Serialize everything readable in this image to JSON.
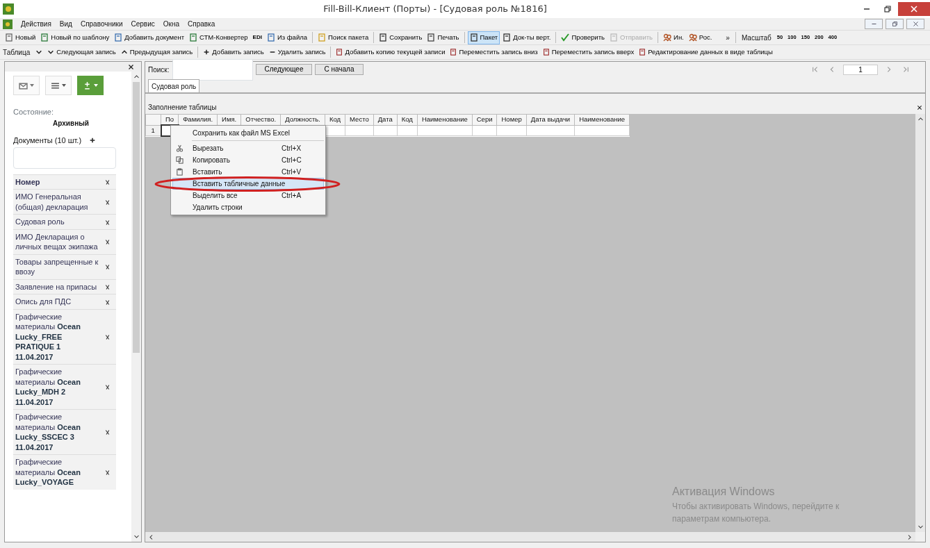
{
  "window": {
    "title": "Fill-Bill-Клиент (Порты) - [Судовая роль №1816]"
  },
  "menu": [
    "Действия",
    "Вид",
    "Справочники",
    "Сервис",
    "Окна",
    "Справка"
  ],
  "toolbar": [
    {
      "label": "Новый",
      "kind": "button",
      "selected": false,
      "disabled": false
    },
    {
      "label": "Новый по шаблону",
      "kind": "button",
      "selected": false,
      "disabled": false
    },
    {
      "label": "Добавить документ",
      "kind": "button",
      "selected": false,
      "disabled": false
    },
    {
      "label": "СТМ-Конвертер",
      "kind": "button",
      "selected": false,
      "disabled": false
    },
    {
      "label": "EDI",
      "kind": "badge",
      "selected": false,
      "disabled": false
    },
    {
      "label": "Из файла",
      "kind": "button",
      "selected": false,
      "disabled": false
    },
    {
      "label": "Поиск пакета",
      "kind": "button",
      "selected": false,
      "disabled": false
    },
    {
      "label": "Сохранить",
      "kind": "button",
      "selected": false,
      "disabled": false
    },
    {
      "label": "Печать",
      "kind": "button",
      "selected": false,
      "disabled": false
    },
    {
      "label": "Пакет",
      "kind": "button",
      "selected": true,
      "disabled": false
    },
    {
      "label": "Док-ты верт.",
      "kind": "button",
      "selected": false,
      "disabled": false
    },
    {
      "label": "Проверить",
      "kind": "button",
      "selected": false,
      "disabled": false
    },
    {
      "label": "Отправить",
      "kind": "button",
      "selected": false,
      "disabled": true
    },
    {
      "label": "Ин.",
      "kind": "button",
      "selected": false,
      "disabled": false
    },
    {
      "label": "Рос.",
      "kind": "button",
      "selected": false,
      "disabled": false
    }
  ],
  "overflow": "»",
  "zoom": {
    "label": "Масштаб",
    "levels": [
      "50",
      "100",
      "150",
      "200",
      "400"
    ]
  },
  "record_toolbar": [
    "Таблица",
    "Следующая запись",
    "Предыдущая запись",
    "Добавить запись",
    "Удалить запись",
    "Добавить копию текущей записи",
    "Переместить запись вниз",
    "Переместить запись вверх",
    "Редактирование данных в виде таблицы"
  ],
  "pager": {
    "value": "1"
  },
  "sidebar": {
    "state_label": "Состояние:",
    "state_value": "Архивный",
    "documents_label": "Документы (10 шт.)",
    "column": "Номер",
    "documents": [
      "ИМО Генеральная (общая) декларация",
      "Судовая роль",
      "ИМО Декларация о личных вещах экипажа",
      "Товары запрещенные к ввозу",
      "Заявление на припасы",
      "Опись для ПДС",
      "Графические материалы **Ocean Lucky_FREE PRATIQUE 1 11.04.2017**",
      "Графические материалы **Ocean Lucky_MDH 2 11.04.2017**",
      "Графические материалы **Ocean Lucky_SSCEC 3 11.04.2017**",
      "Графические материалы **Ocean Lucky_VOYAGE**"
    ]
  },
  "search": {
    "label": "Поиск:",
    "buttons": [
      "Следующее",
      "С начала"
    ]
  },
  "tabs": [
    {
      "label": "Судовая роль",
      "selected": true
    }
  ],
  "grid": {
    "title": "Заполнение таблицы",
    "columns": [
      "По",
      "Фамилия.",
      "Имя.",
      "Отчество.",
      "Должность.",
      "Код",
      "Место",
      "Дата",
      "Код",
      "Наименование",
      "Сери",
      "Номер",
      "Дата выдачи",
      "Наименование"
    ],
    "rows": [
      "1"
    ]
  },
  "context_menu": [
    {
      "label": "Сохранить как файл MS Excel",
      "selected": false,
      "separator_after": true
    },
    {
      "label": "Вырезать",
      "shortcut": "Ctrl+X",
      "selected": false,
      "separator_after": false
    },
    {
      "label": "Копировать",
      "shortcut": "Ctrl+C",
      "selected": false,
      "separator_after": false
    },
    {
      "label": "Вставить",
      "shortcut": "Ctrl+V",
      "selected": false,
      "separator_after": false
    },
    {
      "label": "Вставить табличные данные",
      "selected": true,
      "separator_after": false
    },
    {
      "label": "Выделить все",
      "shortcut": "Ctrl+A",
      "selected": false,
      "separator_after": false
    },
    {
      "label": "Удалить строки",
      "selected": false,
      "separator_after": false
    }
  ],
  "os_notice": {
    "title": "Активация Windows",
    "text": "Чтобы активировать Windows, перейдите к параметрам компьютера."
  }
}
